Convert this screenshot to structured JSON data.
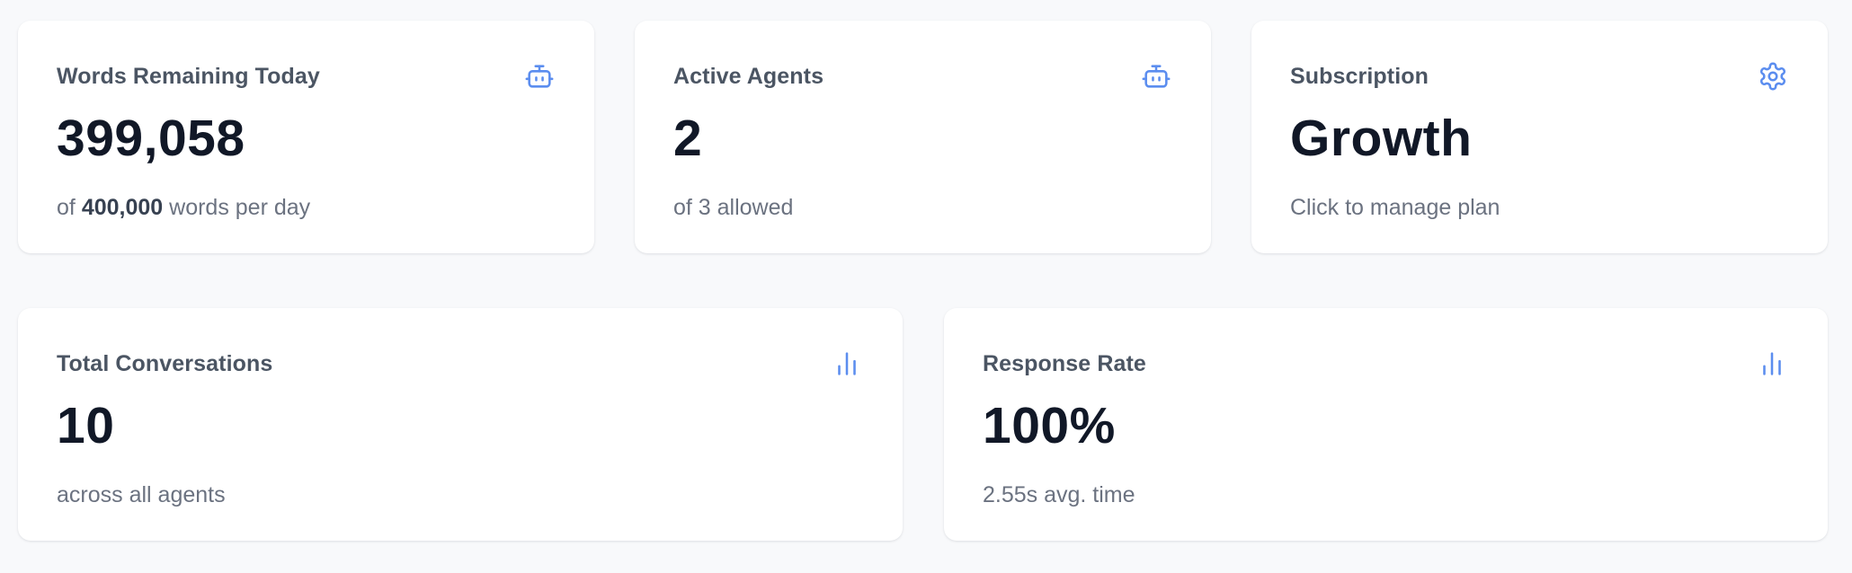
{
  "colors": {
    "accent": "#5b8def",
    "background": "#f8f9fb",
    "card": "#ffffff",
    "title": "#4b5563",
    "value": "#111827",
    "sub": "#6b7280"
  },
  "cards": [
    {
      "title": "Words Remaining Today",
      "value": "399,058",
      "sub_prefix": "of",
      "sub_bold": "400,000",
      "sub_suffix": "words per day",
      "icon": "robot-icon"
    },
    {
      "title": "Active Agents",
      "value": "2",
      "sub": "of 3 allowed",
      "icon": "robot-icon"
    },
    {
      "title": "Subscription",
      "value": "Growth",
      "sub": "Click to manage plan",
      "icon": "gear-icon"
    },
    {
      "title": "Total Conversations",
      "value": "10",
      "sub": "across all agents",
      "icon": "bar-chart-icon"
    },
    {
      "title": "Response Rate",
      "value": "100%",
      "sub": "2.55s avg. time",
      "icon": "bar-chart-icon"
    }
  ]
}
